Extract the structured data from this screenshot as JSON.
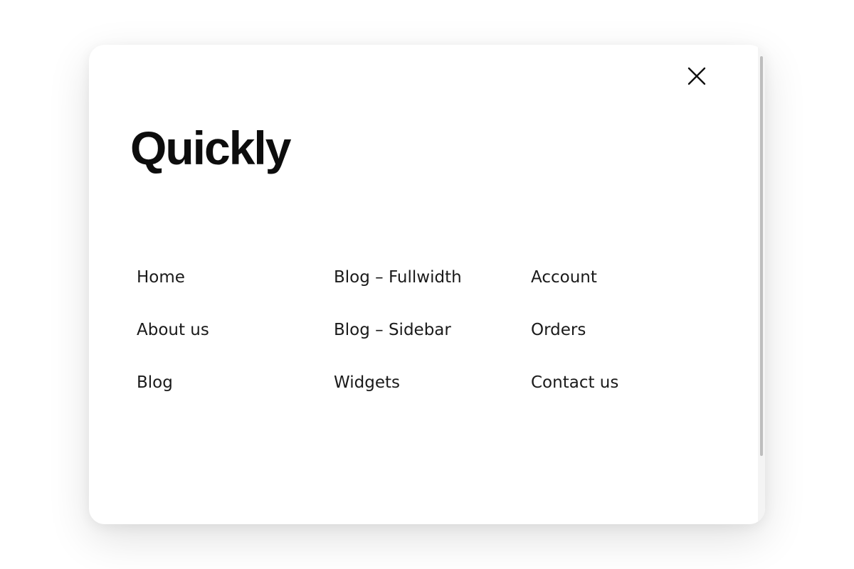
{
  "modal": {
    "logo_text": "Quickly",
    "close_icon": "close-icon",
    "accent": "#0d0d0d",
    "nav": [
      {
        "label": "Home"
      },
      {
        "label": "About us"
      },
      {
        "label": "Blog"
      },
      {
        "label": "Blog – Fullwidth"
      },
      {
        "label": "Blog – Sidebar"
      },
      {
        "label": "Widgets"
      },
      {
        "label": "Account"
      },
      {
        "label": "Orders"
      },
      {
        "label": "Contact us"
      }
    ]
  }
}
